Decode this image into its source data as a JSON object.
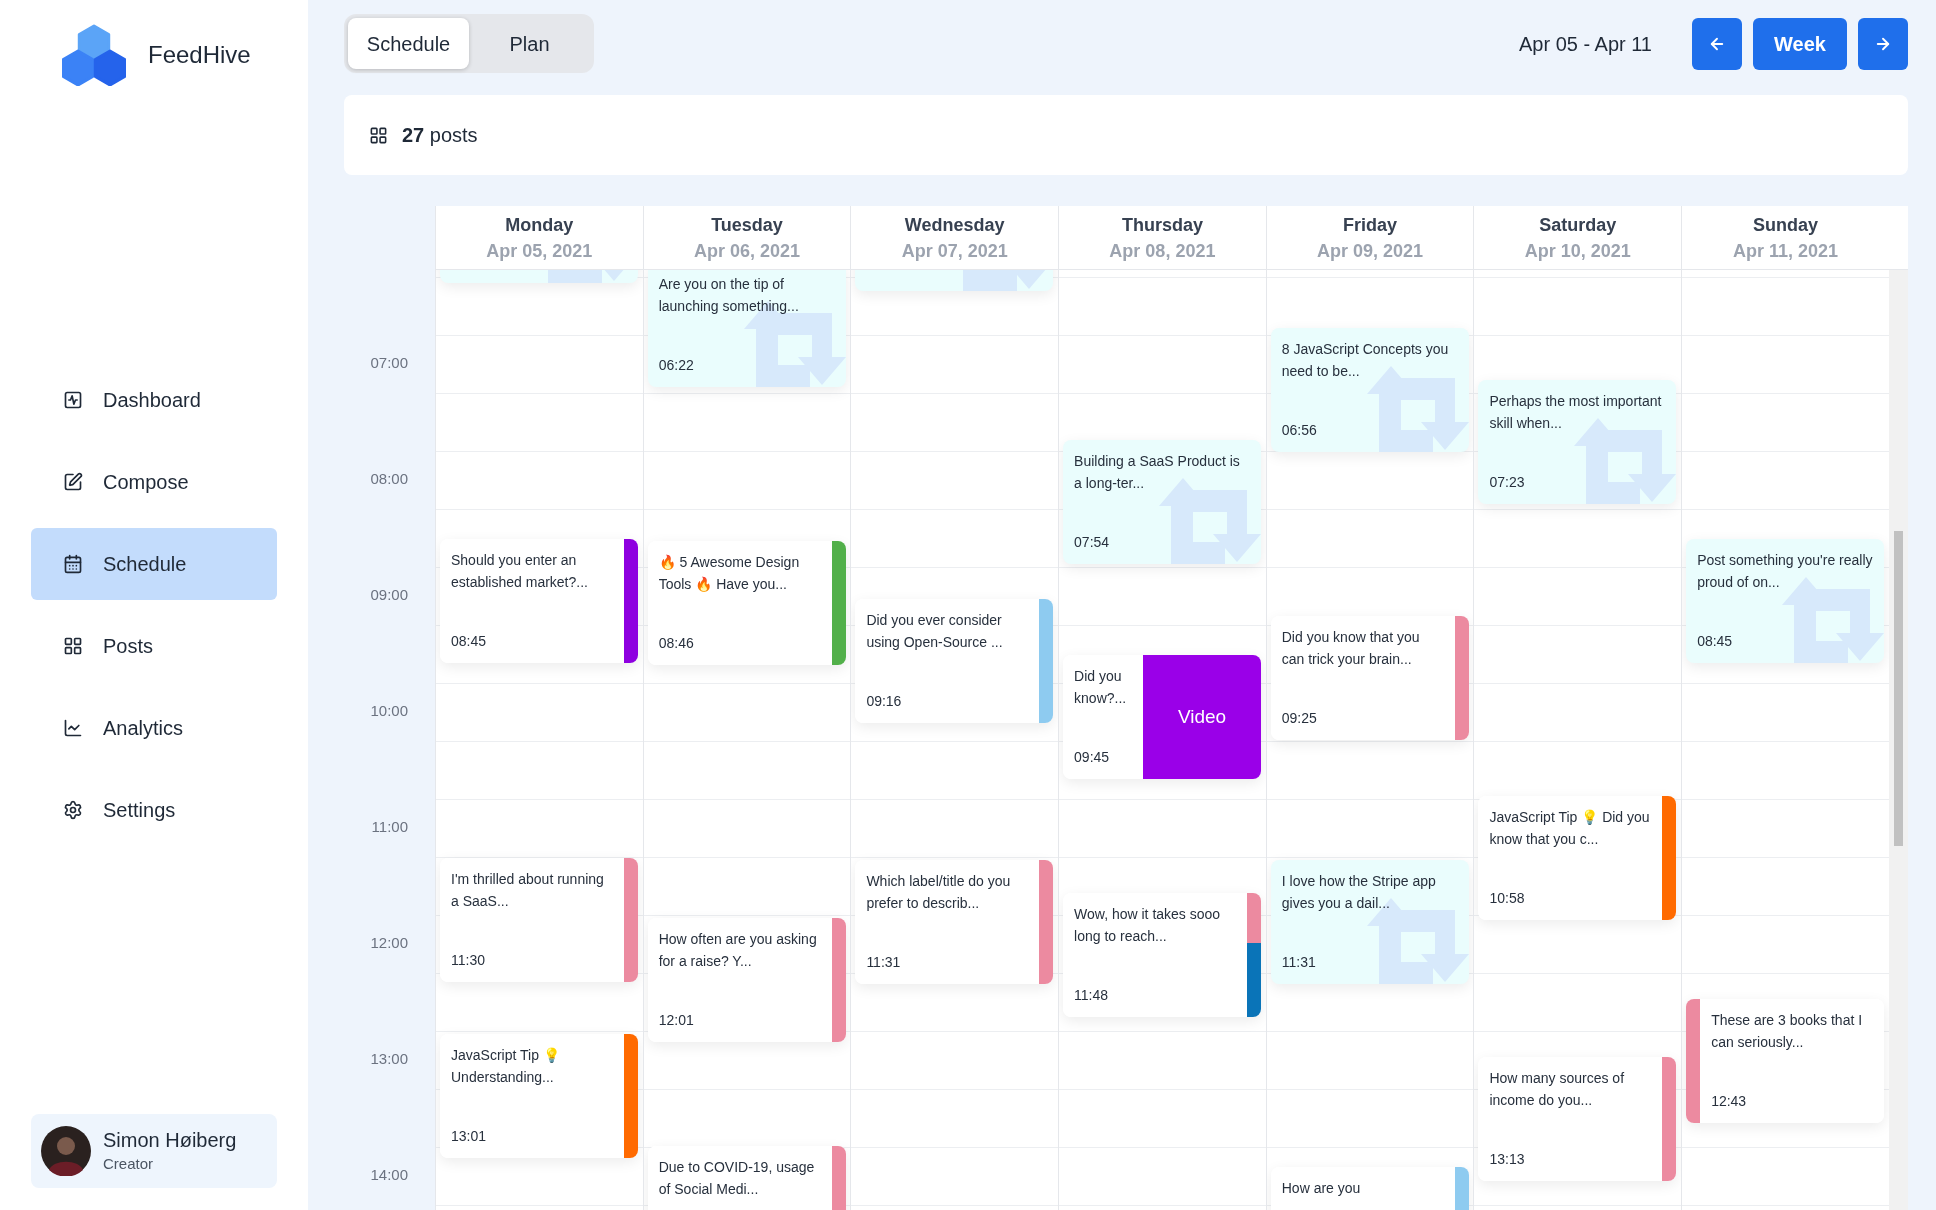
{
  "sidebar": {
    "brand": "FeedHive",
    "nav": [
      {
        "label": "Dashboard",
        "selected": false
      },
      {
        "label": "Compose",
        "selected": false
      },
      {
        "label": "Schedule",
        "selected": true
      },
      {
        "label": "Posts",
        "selected": false
      },
      {
        "label": "Analytics",
        "selected": false
      },
      {
        "label": "Settings",
        "selected": false
      }
    ],
    "user": {
      "name": "Simon Høiberg",
      "role": "Creator"
    }
  },
  "toolbar": {
    "view_tabs": [
      {
        "label": "Schedule",
        "selected": true
      },
      {
        "label": "Plan",
        "selected": false
      }
    ],
    "date_range": "Apr 05 - Apr 11",
    "period_button": "Week"
  },
  "summary": {
    "text": "**27** posts"
  },
  "calendar": {
    "time_labels": [
      "07:00",
      "08:00",
      "09:00",
      "10:00",
      "11:00",
      "12:00",
      "13:00",
      "14:00"
    ],
    "days": [
      {
        "name": "Monday",
        "date": "Apr 05, 2021",
        "posts": [
          {
            "kind": "repost"
          },
          {
            "kind": "accent",
            "text": "Should you enter an established market?...",
            "time": "08:45",
            "color": "#8e00e0"
          },
          {
            "kind": "accent",
            "text": "I'm thrilled about running a SaaS...",
            "time": "11:30",
            "color": "#ec8aa0"
          },
          {
            "kind": "accent",
            "text": "JavaScript Tip 💡 Understanding...",
            "time": "13:01",
            "color": "#ff6a00"
          }
        ]
      },
      {
        "name": "Tuesday",
        "date": "Apr 06, 2021",
        "posts": [
          {
            "kind": "repost",
            "text": "Are you on the tip of launching something...",
            "time": "06:22"
          },
          {
            "kind": "accent",
            "text": "🔥 5 Awesome Design Tools 🔥 Have you...",
            "time": "08:46",
            "color": "#52b04a"
          },
          {
            "kind": "accent",
            "text": "How often are you asking for a raise? Y...",
            "time": "12:01",
            "color": "#ec8aa0"
          },
          {
            "kind": "accent",
            "text": "Due to COVID-19, usage of Social Medi...",
            "color": "#ec8aa0"
          }
        ]
      },
      {
        "name": "Wednesday",
        "date": "Apr 07, 2021",
        "posts": [
          {
            "kind": "repost"
          },
          {
            "kind": "accent",
            "text": "Did you ever consider using Open-Source ...",
            "time": "09:16",
            "color": "#8ecbf0"
          },
          {
            "kind": "accent",
            "text": "Which label/title do you prefer to describ...",
            "time": "11:31",
            "color": "#ec8aa0"
          }
        ]
      },
      {
        "name": "Thursday",
        "date": "Apr 08, 2021",
        "posts": [
          {
            "kind": "repost",
            "text": "Building a SaaS Product is a long-ter...",
            "time": "07:54"
          },
          {
            "kind": "video",
            "text": "Did you know?...",
            "time": "09:45",
            "badge": "Video",
            "color": "#9a00e8"
          },
          {
            "kind": "split",
            "text": "Wow, how it takes sooo long to reach...",
            "time": "11:48",
            "segments": [
              {
                "color": "#ec8aa0"
              },
              {
                "color": "#0a74b8"
              }
            ]
          }
        ]
      },
      {
        "name": "Friday",
        "date": "Apr 09, 2021",
        "posts": [
          {
            "kind": "repost",
            "text": "8 JavaScript Concepts you need to be...",
            "time": "06:56"
          },
          {
            "kind": "accent",
            "text": "Did you know that you can trick your brain...",
            "time": "09:25",
            "color": "#ec8aa0"
          },
          {
            "kind": "repost",
            "text": "I love how the Stripe app gives you a dail...",
            "time": "11:31"
          },
          {
            "kind": "accent",
            "text": "How are you",
            "color": "#8ecbf0"
          }
        ]
      },
      {
        "name": "Saturday",
        "date": "Apr 10, 2021",
        "posts": [
          {
            "kind": "repost",
            "text": "Perhaps the most important skill when...",
            "time": "07:23"
          },
          {
            "kind": "accent",
            "text": "JavaScript Tip 💡 Did you know that you c...",
            "time": "10:58",
            "color": "#ff6a00"
          },
          {
            "kind": "accent",
            "text": "How many sources of income do you...",
            "time": "13:13",
            "color": "#ec8aa0"
          }
        ]
      },
      {
        "name": "Sunday",
        "date": "Apr 11, 2021",
        "posts": [
          {
            "kind": "repost",
            "text": "Post something you're really proud of on...",
            "time": "08:45"
          },
          {
            "kind": "accent_left",
            "text": "These are 3 books that I can seriously...",
            "time": "12:43",
            "color": "#ec8aa0"
          }
        ]
      }
    ]
  }
}
